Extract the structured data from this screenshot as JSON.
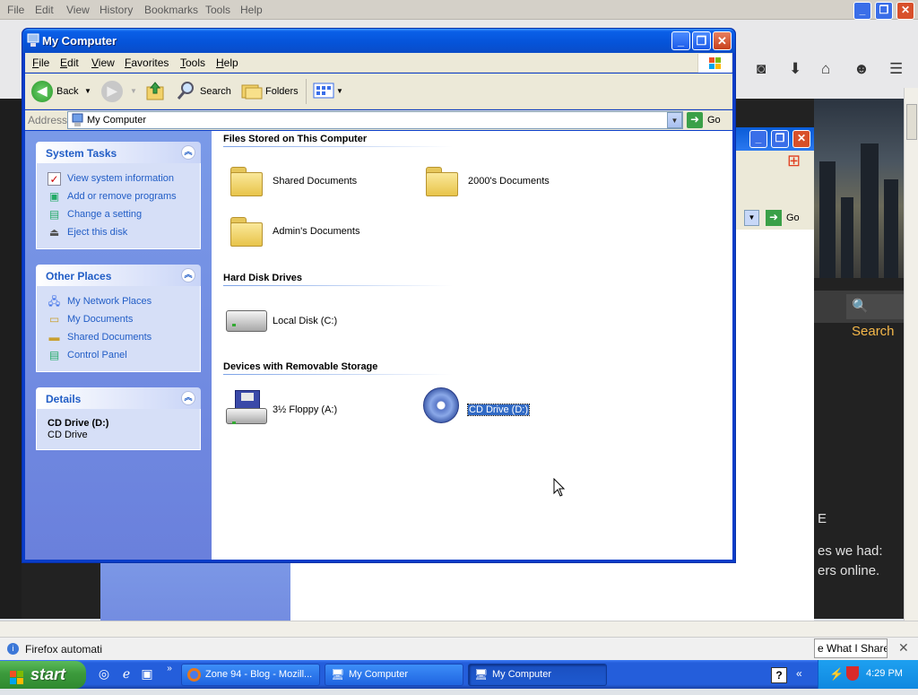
{
  "firefox": {
    "menu": [
      "File",
      "Edit",
      "View",
      "History",
      "Bookmarks",
      "Tools",
      "Help"
    ],
    "search_label": "Search",
    "text0": "E",
    "text1": "es we had:",
    "text2": "ers online.",
    "status_text": "Firefox automati",
    "share_btn": "e What I Share"
  },
  "window": {
    "title": "My Computer",
    "menu": [
      "File",
      "Edit",
      "View",
      "Favorites",
      "Tools",
      "Help"
    ],
    "toolbar": {
      "back": "Back",
      "search": "Search",
      "folders": "Folders"
    },
    "address_label": "Address",
    "address_value": "My Computer",
    "go_label": "Go"
  },
  "left_pane": {
    "system_tasks": {
      "title": "System Tasks",
      "items": [
        "View system information",
        "Add or remove programs",
        "Change a setting",
        "Eject this disk"
      ]
    },
    "other_places": {
      "title": "Other Places",
      "items": [
        "My Network Places",
        "My Documents",
        "Shared Documents",
        "Control Panel"
      ]
    },
    "details": {
      "title": "Details",
      "name": "CD Drive (D:)",
      "type": "CD Drive"
    }
  },
  "right_pane": {
    "sections": {
      "files": "Files Stored on This Computer",
      "hdd": "Hard Disk Drives",
      "removable": "Devices with Removable Storage"
    },
    "files": [
      "Shared Documents",
      "2000's Documents",
      "Admin's Documents"
    ],
    "hdd": [
      "Local Disk (C:)"
    ],
    "removable": [
      "3½ Floppy (A:)",
      "CD Drive (D:)"
    ]
  },
  "taskbar": {
    "start": "start",
    "tasks": [
      "Zone 94 - Blog - Mozill...",
      "My Computer",
      "My Computer"
    ],
    "clock": "4:29 PM"
  },
  "colors": {
    "xp_blue": "#0a5fe8",
    "task_link": "#215dc6",
    "selection": "#316ac5"
  }
}
